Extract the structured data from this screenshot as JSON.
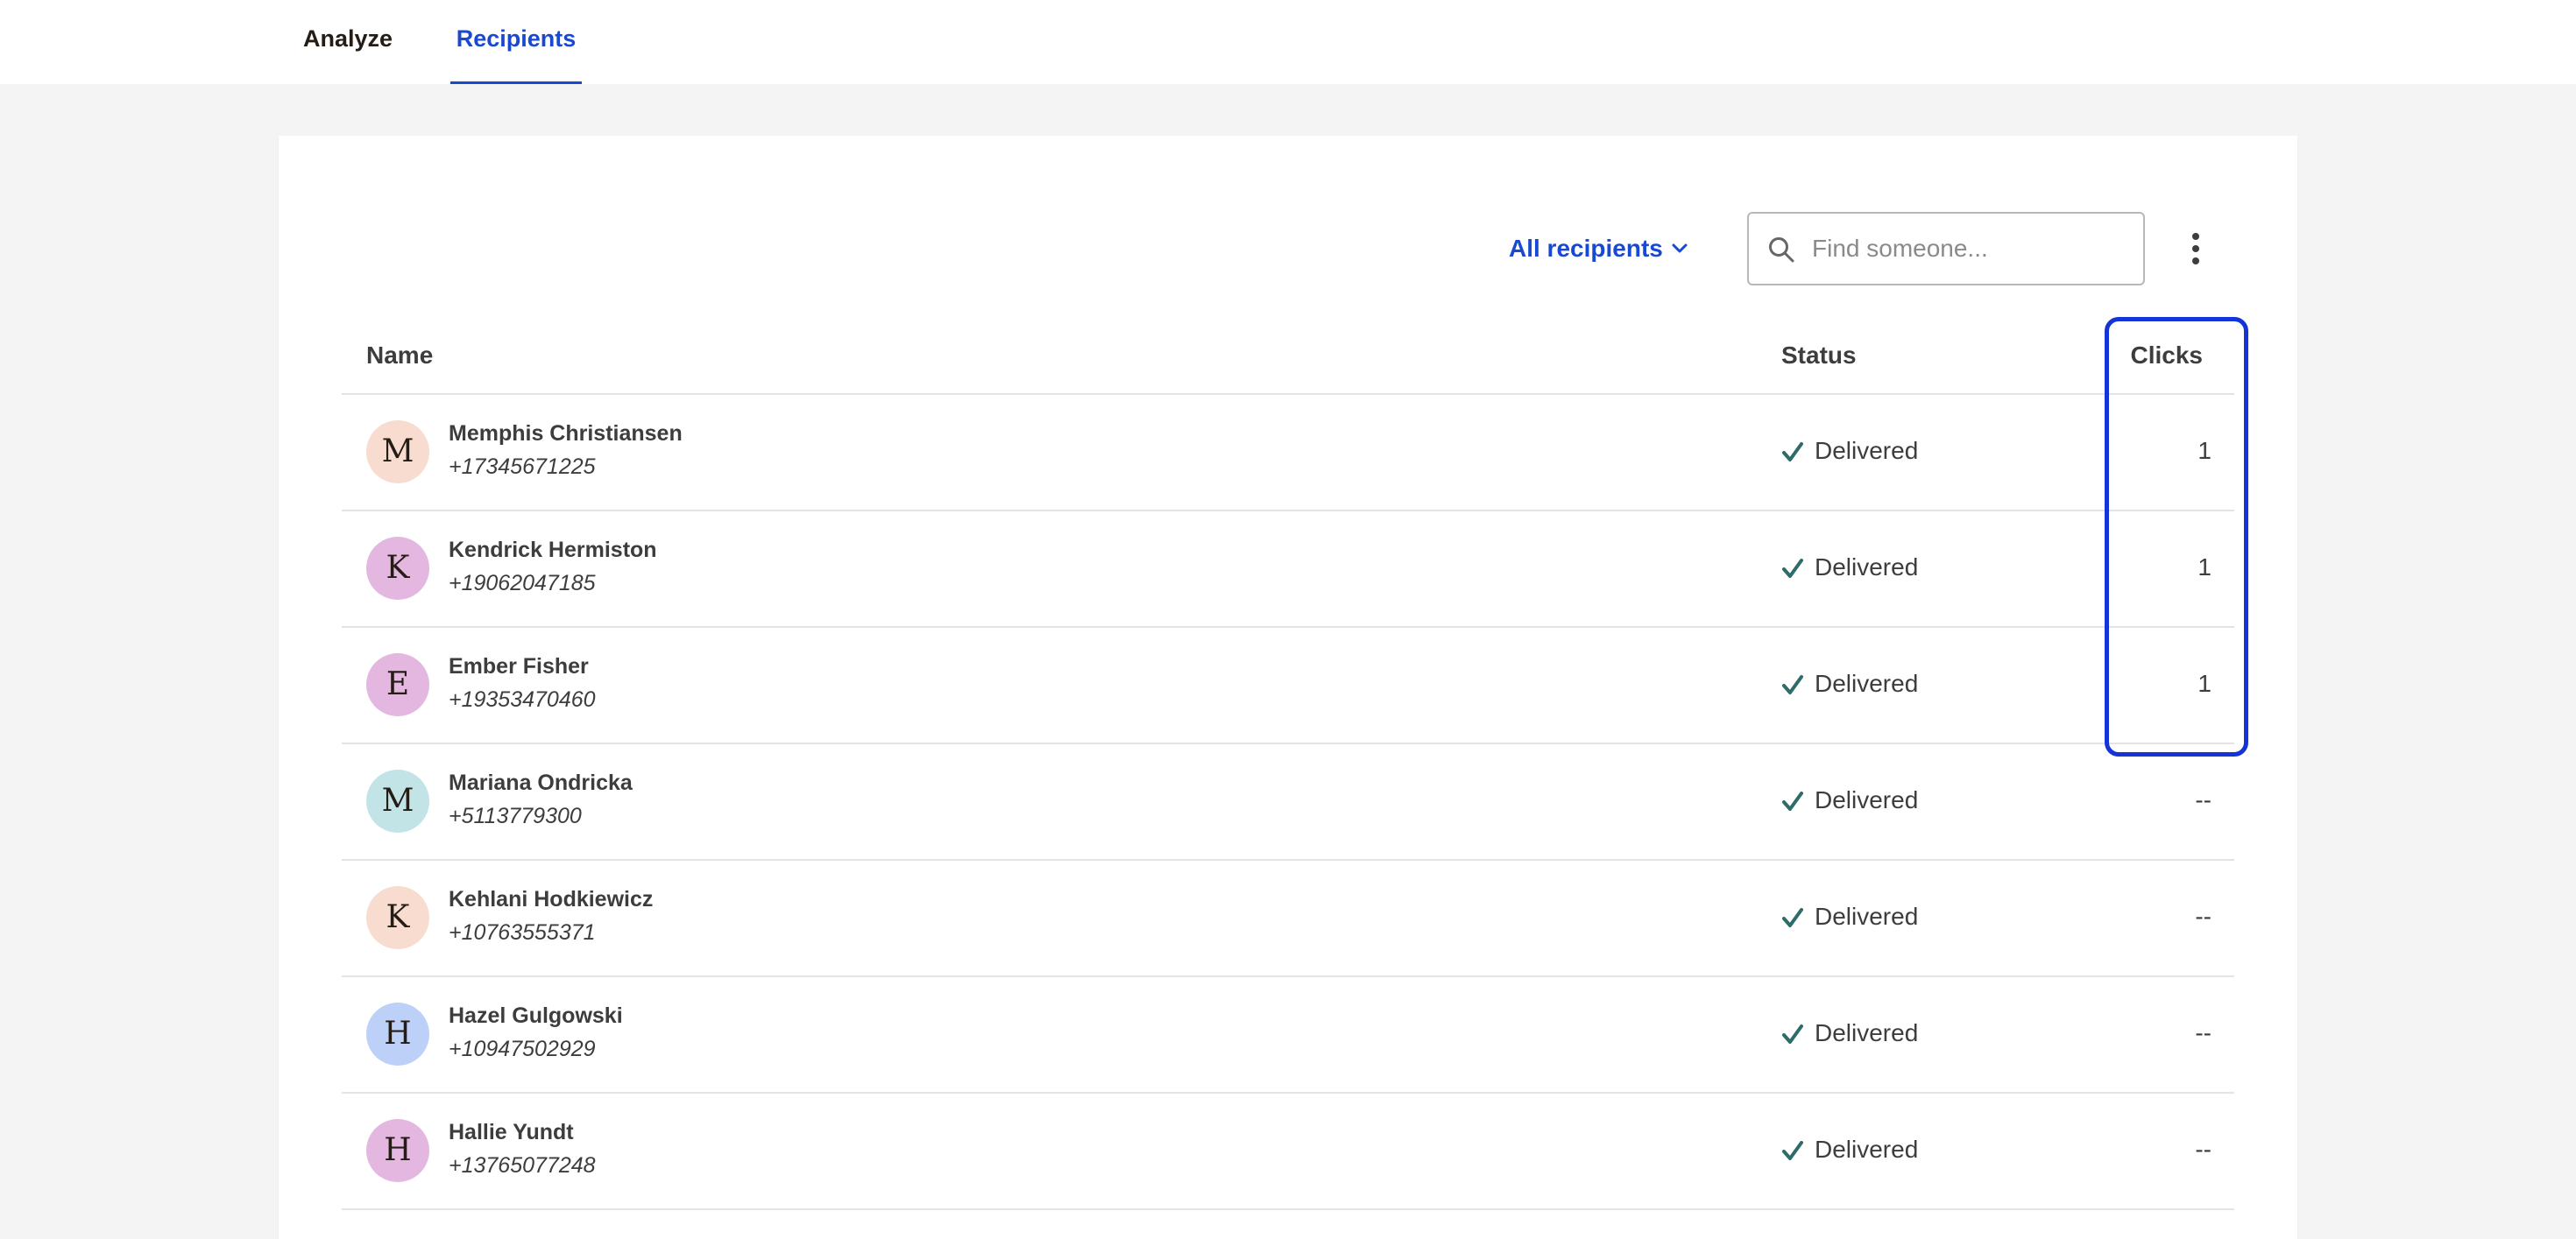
{
  "tabs": [
    {
      "label": "Analyze"
    },
    {
      "label": "Recipients"
    }
  ],
  "filter": {
    "label": "All recipients",
    "icon": "chevron-down-icon"
  },
  "search": {
    "placeholder": "Find someone...",
    "value": "",
    "icon": "search-icon"
  },
  "menu": {
    "icon": "more-vertical-icon"
  },
  "table": {
    "columns": [
      "Name",
      "Status",
      "Clicks"
    ],
    "rows": [
      {
        "initial": "M",
        "name": "Memphis Christiansen",
        "phone": "+17345671225",
        "status": "Delivered",
        "clicks": "1",
        "avatar_color": "#f7dccf"
      },
      {
        "initial": "K",
        "name": "Kendrick Hermiston",
        "phone": "+19062047185",
        "status": "Delivered",
        "clicks": "1",
        "avatar_color": "#e3b7e0"
      },
      {
        "initial": "E",
        "name": "Ember Fisher",
        "phone": "+19353470460",
        "status": "Delivered",
        "clicks": "1",
        "avatar_color": "#e3b7e0"
      },
      {
        "initial": "M",
        "name": "Mariana Ondricka",
        "phone": "+5113779300",
        "status": "Delivered",
        "clicks": "--",
        "avatar_color": "#c3e4e6"
      },
      {
        "initial": "K",
        "name": "Kehlani Hodkiewicz",
        "phone": "+10763555371",
        "status": "Delivered",
        "clicks": "--",
        "avatar_color": "#f7dccf"
      },
      {
        "initial": "H",
        "name": "Hazel Gulgowski",
        "phone": "+10947502929",
        "status": "Delivered",
        "clicks": "--",
        "avatar_color": "#bdd0f8"
      },
      {
        "initial": "H",
        "name": "Hallie Yundt",
        "phone": "+13765077248",
        "status": "Delivered",
        "clicks": "--",
        "avatar_color": "#e3b7e0"
      }
    ]
  },
  "colors": {
    "accent": "#1a49d1",
    "highlight_border": "#1434d8",
    "check": "#2e6b6b"
  }
}
